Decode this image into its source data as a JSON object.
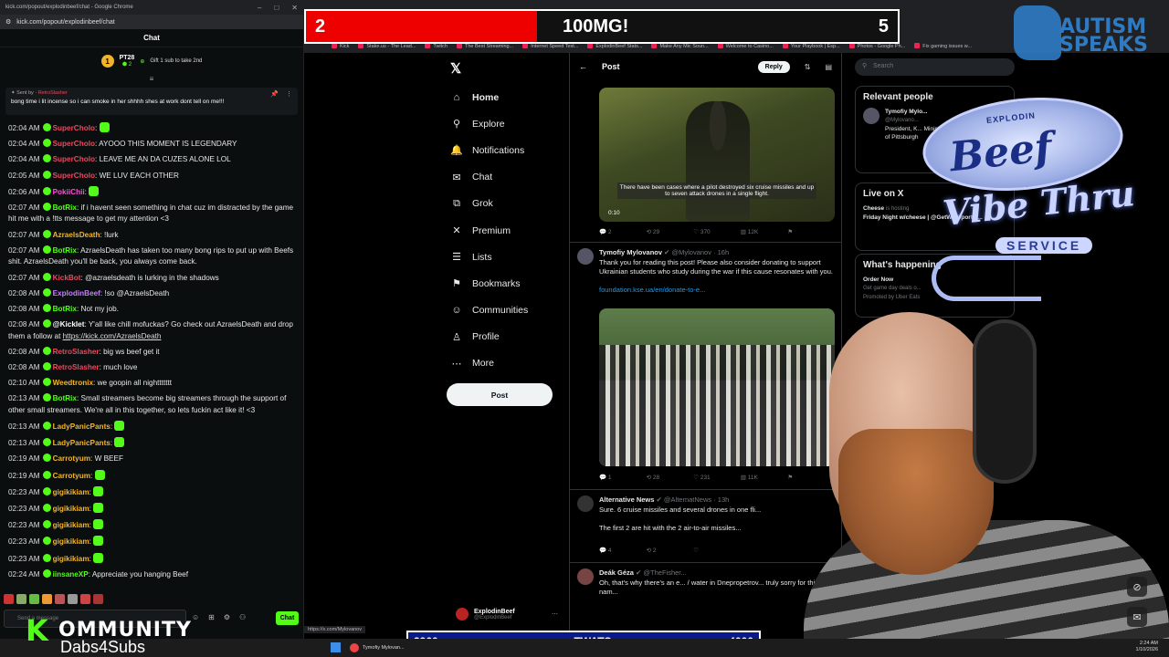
{
  "chat_window": {
    "title": "kick.com/popout/explodinbeef/chat - Google Chrome",
    "url": "kick.com/popout/explodinbeef/chat",
    "header": "Chat",
    "gifter": {
      "rank": "1",
      "name": "PT28",
      "count": "2",
      "desc": "Gift 1 sub to take 2nd"
    },
    "pinned": {
      "sent_by_label": "Sent by",
      "sender": "RetroSlasher",
      "text": "bong time i lit incense so i can smoke in her shhhh shes at work dont tell on me!!!"
    },
    "messages": [
      {
        "time": "02:04 AM",
        "user": "SuperCholo",
        "color": "#e8495f",
        "text": ""
      },
      {
        "time": "02:04 AM",
        "user": "SuperCholo",
        "color": "#e8495f",
        "text": "AYOOO THIS MOMENT IS LEGENDARY"
      },
      {
        "time": "02:04 AM",
        "user": "SuperCholo",
        "color": "#e8495f",
        "text": "LEAVE ME AN DA CUZES ALONE LOL"
      },
      {
        "time": "02:05 AM",
        "user": "SuperCholo",
        "color": "#e8495f",
        "text": "WE LUV EACH OTHER"
      },
      {
        "time": "02:06 AM",
        "user": "PokiiChii",
        "color": "#ff4fd8",
        "text": ""
      },
      {
        "time": "02:07 AM",
        "user": "BotRix",
        "color": "#53fc18",
        "text": "if i havent seen something in chat cuz im distracted by the game hit me with a !tts message to get my attention <3"
      },
      {
        "time": "02:07 AM",
        "user": "AzraelsDeath",
        "color": "#f2b52a",
        "text": "!lurk"
      },
      {
        "time": "02:07 AM",
        "user": "BotRix",
        "color": "#53fc18",
        "text": "AzraelsDeath has taken too many bong rips to put up with Beefs shit. AzraelsDeath you'll be back, you always come back."
      },
      {
        "time": "02:07 AM",
        "user": "KickBot",
        "color": "#e8495f",
        "text": "@azraelsdeath is lurking in the shadows"
      },
      {
        "time": "02:08 AM",
        "user": "ExplodinBeef",
        "color": "#c77dff",
        "text": "!so @AzraelsDeath"
      },
      {
        "time": "02:08 AM",
        "user": "BotRix",
        "color": "#53fc18",
        "text": "Not my job."
      },
      {
        "time": "02:08 AM",
        "user": "@Kicklet",
        "color": "#ffffff",
        "text": "Y'all like chill mofuckas? Go check out AzraelsDeath and drop them a follow at ",
        "link": "https://kick.com/AzraelsDeath"
      },
      {
        "time": "02:08 AM",
        "user": "RetroSlasher",
        "color": "#e8495f",
        "text": "big ws beef get it"
      },
      {
        "time": "02:08 AM",
        "user": "RetroSlasher",
        "color": "#e8495f",
        "text": "much love"
      },
      {
        "time": "02:10 AM",
        "user": "Weedtronix",
        "color": "#f2b52a",
        "text": "we goopin all nighttttttt"
      },
      {
        "time": "02:13 AM",
        "user": "BotRix",
        "color": "#53fc18",
        "text": "Small streamers become big streamers through the support of other small streamers. We're all in this together, so lets fuckin act like it! <3"
      },
      {
        "time": "02:13 AM",
        "user": "LadyPanicPants",
        "color": "#f2b52a",
        "text": ""
      },
      {
        "time": "02:13 AM",
        "user": "LadyPanicPants",
        "color": "#f2b52a",
        "text": ""
      },
      {
        "time": "02:19 AM",
        "user": "Carrotyum",
        "color": "#f2b52a",
        "text": "W BEEF"
      },
      {
        "time": "02:19 AM",
        "user": "Carrotyum",
        "color": "#f2b52a",
        "text": ""
      },
      {
        "time": "02:23 AM",
        "user": "gigikikiam",
        "color": "#f2b52a",
        "text": ""
      },
      {
        "time": "02:23 AM",
        "user": "gigikikiam",
        "color": "#f2b52a",
        "text": ""
      },
      {
        "time": "02:23 AM",
        "user": "gigikikiam",
        "color": "#f2b52a",
        "text": ""
      },
      {
        "time": "02:23 AM",
        "user": "gigikikiam",
        "color": "#f2b52a",
        "text": ""
      },
      {
        "time": "02:23 AM",
        "user": "gigikikiam",
        "color": "#f2b52a",
        "text": ""
      },
      {
        "time": "02:24 AM",
        "user": "iinsaneXP",
        "color": "#53fc18",
        "text": "Appreciate you hanging Beef"
      }
    ],
    "input_placeholder": "Send a message",
    "send_label": "Chat"
  },
  "x_window": {
    "bookmarks": [
      "Kick",
      "Stake.us - The Lead...",
      "Twitch",
      "The Best Streaming...",
      "Internet Speed Test...",
      "ExplodinBeef Stats...",
      "Make Any Mic Soun...",
      "Welcome to Casino...",
      "Your Playbook | Esp...",
      "Photos - Google Ph...",
      "Fix gaming issues w..."
    ],
    "nav": [
      {
        "icon": "⌂",
        "label": "Home",
        "name": "nav-home"
      },
      {
        "icon": "⚲",
        "label": "Explore",
        "name": "nav-explore"
      },
      {
        "icon": "🔔",
        "label": "Notifications",
        "name": "nav-notifications"
      },
      {
        "icon": "✉",
        "label": "Chat",
        "name": "nav-chat"
      },
      {
        "icon": "⧉",
        "label": "Grok",
        "name": "nav-grok"
      },
      {
        "icon": "✕",
        "label": "Premium",
        "name": "nav-premium"
      },
      {
        "icon": "☰",
        "label": "Lists",
        "name": "nav-lists"
      },
      {
        "icon": "⚑",
        "label": "Bookmarks",
        "name": "nav-bookmarks"
      },
      {
        "icon": "☺",
        "label": "Communities",
        "name": "nav-communities"
      },
      {
        "icon": "♙",
        "label": "Profile",
        "name": "nav-profile"
      },
      {
        "icon": "⋯",
        "label": "More",
        "name": "nav-more"
      }
    ],
    "post_button": "Post",
    "account": {
      "name": "ExplodinBeef",
      "handle": "@ExplodinBeef"
    },
    "main": {
      "title": "Post",
      "reply_label": "Reply",
      "video": {
        "caption": "There have been cases where a pilot destroyed six cruise missiles and up to seven attack drones in a single flight.",
        "duration": "0:10"
      },
      "video_stats": {
        "replies": "2",
        "reposts": "29",
        "likes": "370",
        "views": "12K"
      },
      "tweet1": {
        "name": "Tymofiy Mylovanov",
        "handle": "@Mylovanov · 16h",
        "text": "Thank you for reading this post! Please also consider donating to support Ukrainian students who study during the war if this cause resonates with you.",
        "link": "foundation.kse.ua/en/donate-to-e..."
      },
      "photo_stats": {
        "replies": "1",
        "reposts": "28",
        "likes": "231",
        "views": "11K"
      },
      "tweet2": {
        "name": "Alternative News",
        "handle": "@AlternatNews · 13h",
        "text": "Sure. 6 cruise missiles and several drones in one fli...",
        "text2": "The first 2 are hit with the 2 air-to-air missiles...",
        "replies": "4",
        "reposts": "2"
      },
      "tweet3": {
        "name": "Deák Géza",
        "handle": "@TheFisher...",
        "text": "Oh, that's why there's an e... / water in Dnepropetrov... truly sorry for this nam..."
      }
    },
    "right": {
      "search_placeholder": "Search",
      "relevant_title": "Relevant people",
      "relevant_person": {
        "name": "Tymofiy Mylo...",
        "handle": "@Mylovano...",
        "bio": "President, K... Minister of e... 2020; Associ... of Pittsburgh"
      },
      "live_title": "Live on X",
      "live_item": {
        "host": "Cheese",
        "status": "is hosting",
        "title": "Friday Night w/cheese | @GetWetSports ..."
      },
      "happening_title": "What's happening",
      "happening_item": {
        "title": "Order Now",
        "desc": "Get game day deals o...",
        "promo": "Promoted by Uber Eats"
      }
    },
    "status_url": "https://x.com/Mylovanov"
  },
  "overlays": {
    "score": {
      "current": "2",
      "label": "100MG!",
      "target": "5"
    },
    "autism_text": "AUTISM SPEAKS",
    "sign": {
      "top": "EXPLODIN",
      "main": "Beef",
      "vibe": "Vibe Thru",
      "service": "SERVICE"
    },
    "twats": {
      "current": "3960",
      "label": "TWATS",
      "target": "4000"
    },
    "kommunity": {
      "k": "K",
      "rest": "OMMUNITY",
      "sub": "Dabs4Subs"
    }
  },
  "taskbar": {
    "app_label": "Tymofiy Mylovan...",
    "time": "2:24 AM",
    "date": "1/10/2026"
  }
}
